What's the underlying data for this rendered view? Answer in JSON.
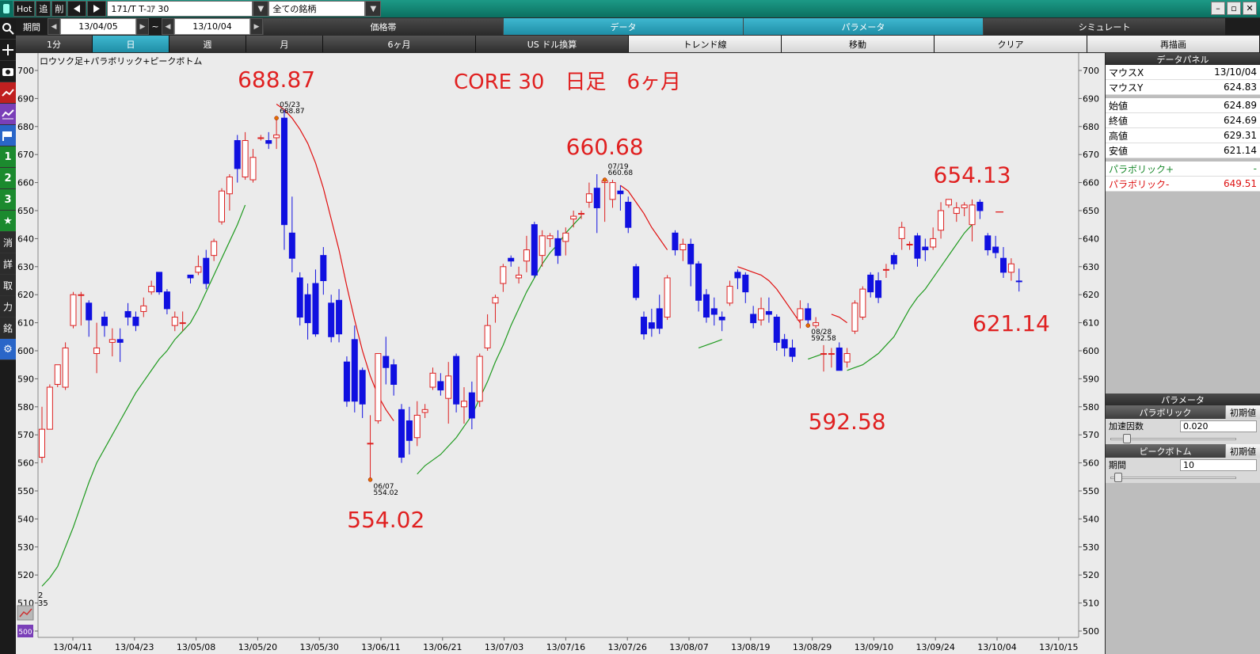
{
  "titlebar": {
    "hot": "Hot",
    "btn_tsui": "追",
    "btn_saku": "削",
    "symbol": "171/T T-ｺｱ 30",
    "universe": "全ての銘柄"
  },
  "period": {
    "label": "期間",
    "from": "13/04/05",
    "tilde": "~",
    "to": "13/10/04"
  },
  "top_tabs": [
    "価格帯",
    "データ",
    "パラメータ",
    "シミュレート"
  ],
  "top_tabs_active": 1,
  "sub_tabs": [
    "1分",
    "日",
    "週",
    "月",
    "6ヶ月",
    "US ドル換算",
    "トレンド線",
    "移動",
    "クリア",
    "再描画"
  ],
  "chart_caption": "ロウソク足+パラボリック+ピークボトム",
  "overlay_title": "CORE 30　日足　6ヶ月",
  "corner_marks": [
    "2",
    "35"
  ],
  "data_panel": {
    "title": "データパネル",
    "rows": [
      {
        "label": "マウスX",
        "value": "13/10/04"
      },
      {
        "label": "マウスY",
        "value": "624.83"
      }
    ],
    "ohlc": [
      {
        "label": "始値",
        "value": "624.89"
      },
      {
        "label": "終値",
        "value": "624.69"
      },
      {
        "label": "高値",
        "value": "629.31"
      },
      {
        "label": "安値",
        "value": "621.14"
      }
    ],
    "sar_up": {
      "label": "パラボリック+",
      "value": "-"
    },
    "sar_down": {
      "label": "パラボリック-",
      "value": "649.51"
    }
  },
  "param_panel": {
    "title": "パラメータ",
    "parabolic": "パラボリック",
    "reset": "初期値",
    "accel_label": "加速因数",
    "accel_value": "0.020",
    "peak_bottom": "ピークボトム",
    "period_label": "期間",
    "period_value": "10",
    "accel_level": 0.02,
    "period_level": 0.03
  },
  "colors": {
    "up_candle": "#dd2020",
    "down_candle": "#1010e0",
    "sar_up": "#1f9a1f",
    "sar_down": "#e01010",
    "annotation": "#e02020",
    "active_tab": "#2a9fb8"
  },
  "chart_data": {
    "type": "candlestick",
    "title": "CORE 30　日足　6ヶ月",
    "ylim": [
      500,
      700
    ],
    "y_ticks": [
      500,
      510,
      520,
      530,
      540,
      550,
      560,
      570,
      580,
      590,
      600,
      610,
      620,
      630,
      640,
      650,
      660,
      670,
      680,
      690,
      700
    ],
    "x_tick_labels": [
      "13/04/11",
      "13/04/23",
      "13/05/08",
      "13/05/20",
      "13/05/30",
      "13/06/11",
      "13/06/21",
      "13/07/03",
      "13/07/16",
      "13/07/26",
      "13/08/07",
      "13/08/19",
      "13/08/29",
      "13/09/10",
      "13/09/24",
      "13/10/04",
      "13/10/15"
    ],
    "grid": false,
    "candles": [
      [
        562,
        572,
        580,
        560
      ],
      [
        572,
        587,
        588,
        572
      ],
      [
        588,
        595,
        595,
        587
      ],
      [
        587,
        601,
        603,
        586
      ],
      [
        609,
        620,
        621,
        608
      ],
      [
        620,
        620,
        621,
        609
      ],
      [
        617,
        611,
        618,
        605
      ],
      [
        599,
        601,
        610,
        592
      ],
      [
        612,
        609,
        614,
        605
      ],
      [
        603,
        604,
        608,
        598
      ],
      [
        604,
        603,
        608,
        596
      ],
      [
        614,
        612,
        617,
        609
      ],
      [
        612,
        609,
        614,
        607
      ],
      [
        614,
        616,
        619,
        612
      ],
      [
        621,
        623,
        625,
        620
      ],
      [
        628,
        621,
        628,
        620
      ],
      [
        621,
        615,
        622,
        613
      ],
      [
        609,
        612,
        614,
        607
      ],
      [
        610,
        610,
        614,
        607
      ],
      [
        627,
        626,
        627,
        624
      ],
      [
        628,
        630,
        634,
        627
      ],
      [
        633,
        624,
        636,
        622
      ],
      [
        634,
        639,
        640,
        632
      ],
      [
        646,
        657,
        658,
        645
      ],
      [
        656,
        662,
        663,
        650
      ],
      [
        675,
        665,
        677,
        660
      ],
      [
        662,
        675,
        678,
        661
      ],
      [
        661,
        669,
        672,
        660
      ],
      [
        676,
        676,
        677,
        675
      ],
      [
        675,
        674,
        678,
        672
      ],
      [
        676,
        677,
        683,
        672
      ],
      [
        683,
        645,
        686,
        636
      ],
      [
        642,
        633,
        655,
        628
      ],
      [
        626,
        612,
        628,
        609
      ],
      [
        620,
        610,
        624,
        604
      ],
      [
        624,
        606,
        629,
        605
      ],
      [
        634,
        625,
        637,
        620
      ],
      [
        617,
        605,
        620,
        603
      ],
      [
        618,
        606,
        622,
        603
      ],
      [
        596,
        582,
        598,
        580
      ],
      [
        604,
        582,
        609,
        578
      ],
      [
        593,
        581,
        594,
        576
      ],
      [
        567,
        567,
        577,
        554
      ],
      [
        575,
        599,
        599,
        574
      ],
      [
        598,
        594,
        605,
        588
      ],
      [
        595,
        588,
        597,
        584
      ],
      [
        579,
        562,
        581,
        560
      ],
      [
        575,
        568,
        580,
        563
      ],
      [
        569,
        577,
        582,
        566
      ],
      [
        578,
        579,
        581,
        576
      ],
      [
        587,
        592,
        594,
        586
      ],
      [
        589,
        586,
        592,
        584
      ],
      [
        583,
        591,
        596,
        574
      ],
      [
        598,
        581,
        599,
        578
      ],
      [
        580,
        582,
        587,
        574
      ],
      [
        585,
        576,
        589,
        572
      ],
      [
        582,
        598,
        599,
        580
      ],
      [
        601,
        609,
        613,
        600
      ],
      [
        617,
        619,
        620,
        610
      ],
      [
        624,
        630,
        631,
        621
      ],
      [
        633,
        632,
        634,
        630
      ],
      [
        626,
        627,
        630,
        624
      ],
      [
        632,
        636,
        641,
        628
      ],
      [
        645,
        627,
        646,
        626
      ],
      [
        634,
        641,
        643,
        630
      ],
      [
        640,
        641,
        642,
        637
      ],
      [
        640,
        634,
        643,
        631
      ],
      [
        639,
        642,
        644,
        634
      ],
      [
        647,
        648,
        650,
        644
      ],
      [
        649,
        649,
        650,
        647
      ],
      [
        653,
        656,
        660,
        651
      ],
      [
        658,
        651,
        663,
        642
      ],
      [
        660,
        660.68,
        661,
        646
      ],
      [
        654,
        660,
        661,
        651
      ],
      [
        657,
        656,
        659,
        650
      ],
      [
        653,
        644,
        655,
        642
      ],
      [
        630,
        619,
        631,
        618
      ],
      [
        612,
        606,
        614,
        604
      ],
      [
        610,
        608,
        615,
        605
      ],
      [
        615,
        608,
        620,
        606
      ],
      [
        612,
        626,
        627,
        611
      ],
      [
        642,
        636,
        643,
        634
      ],
      [
        636,
        638,
        640,
        632
      ],
      [
        638,
        631,
        640,
        623
      ],
      [
        631,
        618,
        632,
        614
      ],
      [
        620,
        612,
        622,
        610
      ],
      [
        615,
        613,
        619,
        609
      ],
      [
        612,
        611,
        614,
        607
      ],
      [
        617,
        623,
        625,
        616
      ],
      [
        628,
        626,
        629,
        622
      ],
      [
        627,
        621,
        628,
        617
      ],
      [
        613,
        610,
        616,
        608
      ],
      [
        611,
        615,
        619,
        609
      ],
      [
        614,
        613,
        619,
        610
      ],
      [
        612,
        603,
        613,
        600
      ],
      [
        604,
        601,
        606,
        598
      ],
      [
        601,
        598,
        604,
        596
      ],
      [
        611,
        615,
        618,
        608
      ],
      [
        615,
        611,
        617,
        609
      ],
      [
        609,
        610,
        612,
        608
      ],
      [
        599,
        599,
        602,
        592.58
      ],
      [
        599,
        599,
        601,
        594
      ],
      [
        601,
        593,
        603,
        593
      ],
      [
        596,
        599,
        601,
        594
      ],
      [
        607,
        617,
        618,
        606
      ],
      [
        612,
        622,
        623,
        611
      ],
      [
        627,
        621,
        628,
        619
      ],
      [
        625,
        619,
        628,
        617
      ],
      [
        629,
        629,
        631,
        626
      ],
      [
        634,
        631,
        635,
        629
      ],
      [
        640,
        644,
        646,
        636
      ],
      [
        638,
        638,
        639,
        636
      ],
      [
        641,
        633,
        642,
        630
      ],
      [
        637,
        636,
        640,
        632
      ],
      [
        637,
        640,
        644,
        636
      ],
      [
        643,
        650,
        653,
        640
      ],
      [
        652,
        654,
        654.13,
        651
      ],
      [
        649,
        651,
        653,
        646
      ],
      [
        651,
        652,
        653,
        648
      ],
      [
        645,
        652,
        654,
        639
      ],
      [
        653,
        650,
        654,
        647
      ],
      [
        641,
        636,
        642,
        634
      ],
      [
        637,
        635,
        641,
        633
      ],
      [
        633,
        628,
        637,
        626
      ],
      [
        628,
        631,
        633,
        625
      ],
      [
        624.89,
        624.69,
        629.31,
        621.14
      ]
    ],
    "sar_plus_segments": [
      {
        "from": 0,
        "values": [
          516,
          519,
          523,
          530,
          537,
          545,
          553,
          560,
          565,
          570,
          575,
          580,
          585,
          589,
          593,
          597,
          600,
          604,
          607,
          610,
          615,
          621,
          627,
          633,
          639,
          645,
          652
        ]
      },
      {
        "from": 48,
        "values": [
          556,
          559,
          561,
          563,
          566,
          569,
          573,
          577,
          583,
          589,
          596,
          602,
          609,
          615,
          621,
          626,
          631,
          635,
          638,
          642,
          645,
          648
        ]
      },
      {
        "from": 84,
        "values": [
          601,
          602,
          603,
          604
        ]
      },
      {
        "from": 98,
        "values": [
          597,
          598,
          599
        ]
      },
      {
        "from": 103,
        "values": [
          593,
          594,
          595,
          597,
          599,
          602,
          605,
          610,
          615,
          619,
          622,
          626,
          630,
          634,
          638,
          642,
          645
        ]
      }
    ],
    "sar_minus_segments": [
      {
        "from": 30,
        "values": [
          688,
          686,
          683,
          679,
          674,
          667,
          658,
          647,
          636,
          623,
          611,
          600,
          591,
          584,
          579,
          575
        ]
      },
      {
        "from": 74,
        "values": [
          659,
          657,
          653,
          649,
          644,
          640,
          636
        ]
      },
      {
        "from": 89,
        "values": [
          630,
          629,
          628,
          627,
          625,
          622,
          618,
          614,
          610
        ]
      },
      {
        "from": 101,
        "values": [
          613,
          612,
          610
        ]
      },
      {
        "from": 122,
        "values": [
          649.5,
          649.51
        ]
      }
    ],
    "peaks": [
      {
        "index": 30,
        "date": "05/23",
        "value": "688.87",
        "kind": "peak"
      },
      {
        "index": 42,
        "date": "06/07",
        "value": "554.02",
        "kind": "bottom"
      },
      {
        "index": 72,
        "date": "07/19",
        "value": "660.68",
        "kind": "peak"
      },
      {
        "index": 98,
        "date": "08/28",
        "value": "592.58",
        "kind": "bottom"
      }
    ],
    "annotations": [
      {
        "text": "688.87",
        "index": 30,
        "value": 694,
        "anchor": "middle"
      },
      {
        "text": "554.02",
        "index": 44,
        "value": 537,
        "anchor": "middle"
      },
      {
        "text": "660.68",
        "index": 72,
        "value": 670,
        "anchor": "middle"
      },
      {
        "text": "592.58",
        "index": 103,
        "value": 572,
        "anchor": "middle"
      },
      {
        "text": "654.13",
        "index": 119,
        "value": 660,
        "anchor": "middle"
      },
      {
        "text": "621.14",
        "index": 124,
        "value": 607,
        "anchor": "middle"
      }
    ]
  }
}
